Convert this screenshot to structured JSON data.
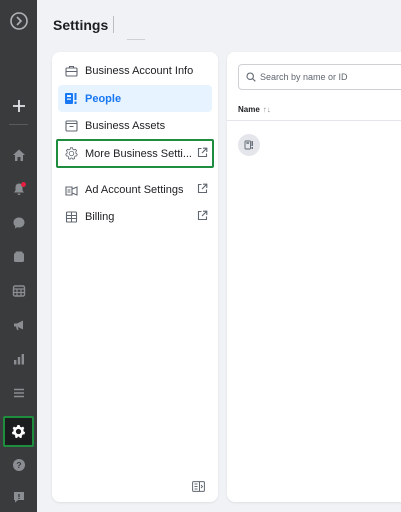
{
  "header": {
    "title": "Settings"
  },
  "rail": {
    "icons": [
      "logo-circle-icon",
      "plus-icon",
      "home-icon",
      "notifications-icon",
      "chat-icon",
      "pages-icon",
      "calendar-icon",
      "megaphone-icon",
      "insights-icon",
      "menu-icon",
      "settings-gear-icon",
      "help-icon",
      "feedback-icon"
    ],
    "accent": "#1e8e3e"
  },
  "settings_nav": {
    "items": [
      {
        "label": "Business Account Info",
        "icon": "briefcase-icon",
        "external": false,
        "active": false
      },
      {
        "label": "People",
        "icon": "people-icon",
        "external": false,
        "active": true
      },
      {
        "label": "Business Assets",
        "icon": "assets-icon",
        "external": false,
        "active": false
      },
      {
        "label": "More Business Setti...",
        "icon": "gear-icon",
        "external": true,
        "active": false
      },
      {
        "label": "Ad Account Settings",
        "icon": "ad-account-icon",
        "external": true,
        "active": false
      },
      {
        "label": "Billing",
        "icon": "billing-icon",
        "external": true,
        "active": false
      }
    ],
    "active_color": "#1877f2"
  },
  "content": {
    "search_placeholder": "Search by name or ID",
    "column_name": "Name",
    "sort_glyph": "↑↓"
  }
}
